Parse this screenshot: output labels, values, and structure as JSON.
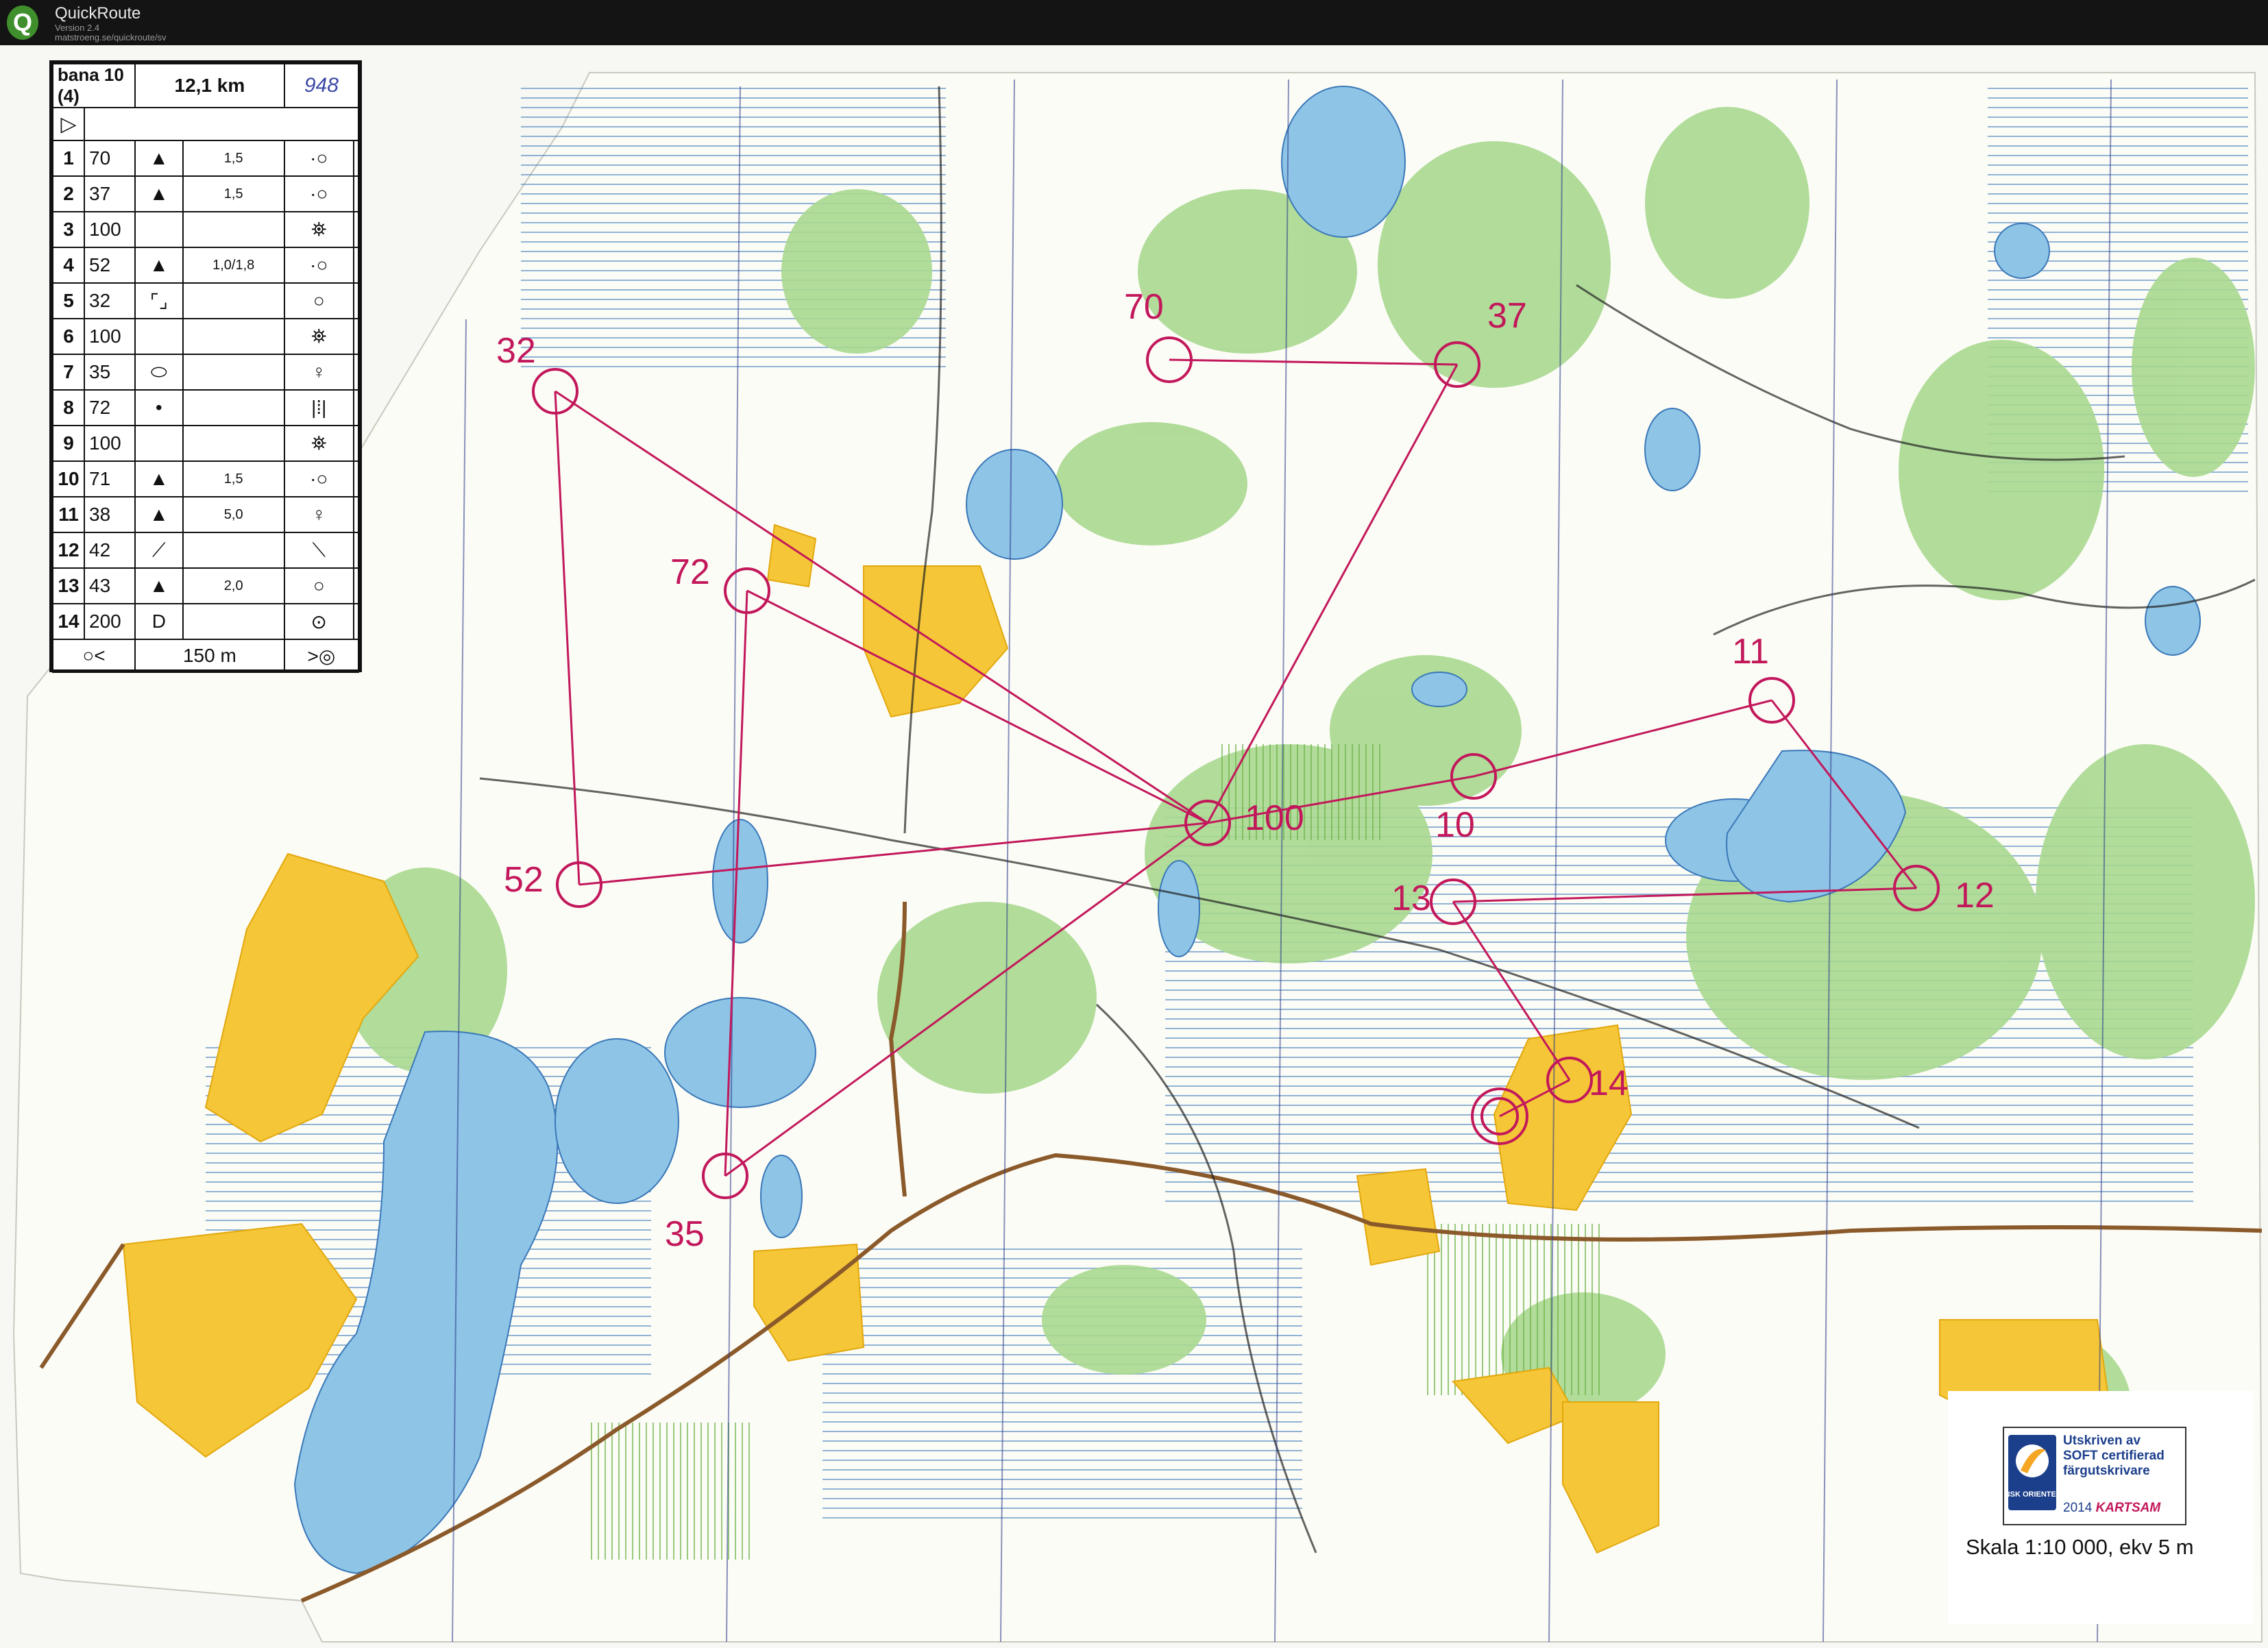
{
  "app": {
    "logo_letter": "Q",
    "title": "QuickRoute",
    "version": "Version 2.4",
    "url": "matstroeng.se/quickroute/sv"
  },
  "course": {
    "name": "bana 10 (4)",
    "length": "12,1 km",
    "handwritten": "948",
    "start_symbol": "▷",
    "controls": [
      {
        "n": "1",
        "code": "70",
        "feature": "▲",
        "size": "1,5",
        "detail": "·○"
      },
      {
        "n": "2",
        "code": "37",
        "feature": "▲",
        "size": "1,5",
        "detail": "·○"
      },
      {
        "n": "3",
        "code": "100",
        "feature": "",
        "size": "",
        "detail": "⛯"
      },
      {
        "n": "4",
        "code": "52",
        "feature": "▲",
        "size": "1,0/1,8",
        "detail": "·○"
      },
      {
        "n": "5",
        "code": "32",
        "feature": "⌜⌟",
        "size": "",
        "detail": "○"
      },
      {
        "n": "6",
        "code": "100",
        "feature": "",
        "size": "",
        "detail": "⛯"
      },
      {
        "n": "7",
        "code": "35",
        "feature": "⬭",
        "size": "",
        "detail": "♀"
      },
      {
        "n": "8",
        "code": "72",
        "feature": "•",
        "size": "",
        "detail": "|⁞|"
      },
      {
        "n": "9",
        "code": "100",
        "feature": "",
        "size": "",
        "detail": "⛯"
      },
      {
        "n": "10",
        "code": "71",
        "feature": "▲",
        "size": "1,5",
        "detail": "·○"
      },
      {
        "n": "11",
        "code": "38",
        "feature": "▲",
        "size": "5,0",
        "detail": "♀"
      },
      {
        "n": "12",
        "code": "42",
        "feature": "⟋",
        "size": "",
        "detail": "⟍"
      },
      {
        "n": "13",
        "code": "43",
        "feature": "▲",
        "size": "2,0",
        "detail": "○"
      },
      {
        "n": "14",
        "code": "200",
        "feature": "D",
        "size": "",
        "detail": "⊙"
      }
    ],
    "finish_distance": "150 m",
    "finish_left": "○<",
    "finish_right": ">◎"
  },
  "map": {
    "water_color": "#8ec4e6",
    "forest_green": "#a8d890",
    "open_yellow": "#f5c637",
    "course_magenta": "#c2185b",
    "road_brown": "#8b5a2b",
    "control_labels": [
      {
        "label": "70"
      },
      {
        "label": "37"
      },
      {
        "label": "32"
      },
      {
        "label": "72"
      },
      {
        "label": "100"
      },
      {
        "label": "52"
      },
      {
        "label": "11"
      },
      {
        "label": "10"
      },
      {
        "label": "13"
      },
      {
        "label": "12"
      },
      {
        "label": "14"
      },
      {
        "label": "35"
      }
    ]
  },
  "legend": {
    "badge_line1": "Utskriven av",
    "badge_line2": "SOFT certifierad",
    "badge_line3": "färgutskrivare",
    "badge_year": "2014",
    "badge_brand": "KARTSAM",
    "badge_org": "SVENSK ORIENTERING",
    "scale": "Skala 1:10 000, ekv 5 m"
  }
}
